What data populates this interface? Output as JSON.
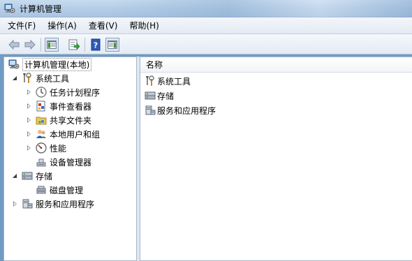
{
  "window": {
    "title": "计算机管理"
  },
  "menu": {
    "items": [
      "文件(F)",
      "操作(A)",
      "查看(V)",
      "帮助(H)"
    ]
  },
  "toolbar": {
    "buttons": [
      "back-arrow-icon",
      "forward-arrow-icon",
      "show-hide-console-tree-icon",
      "export-list-icon",
      "help-icon",
      "show-hide-action-pane-icon"
    ]
  },
  "tree": {
    "root": "计算机管理(本地)",
    "system_tools": {
      "label": "系统工具",
      "children": [
        "任务计划程序",
        "事件查看器",
        "共享文件夹",
        "本地用户和组",
        "性能",
        "设备管理器"
      ]
    },
    "storage": {
      "label": "存储",
      "children": [
        "磁盘管理"
      ]
    },
    "services": {
      "label": "服务和应用程序"
    }
  },
  "list": {
    "column_name": "名称",
    "items": [
      "系统工具",
      "存储",
      "服务和应用程序"
    ]
  }
}
